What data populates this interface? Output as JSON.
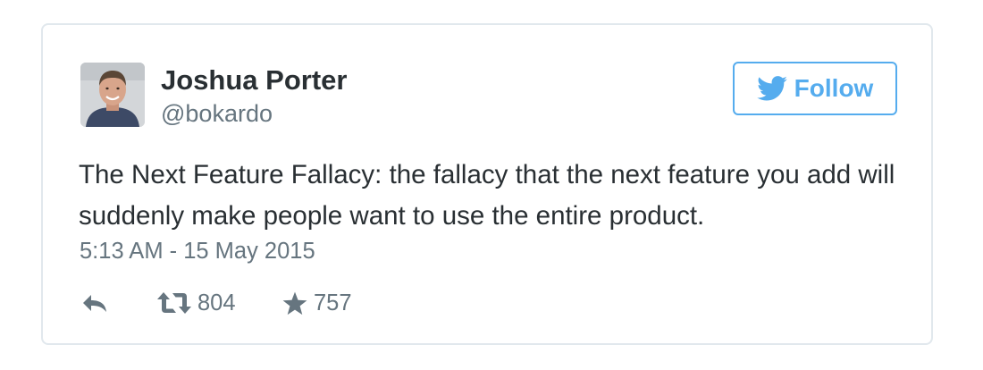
{
  "author": {
    "display_name": "Joshua Porter",
    "screen_name": "@bokardo",
    "avatar_icon": "profile-photo"
  },
  "follow_button": {
    "label": "Follow",
    "icon": "twitter-bird-icon",
    "color": "#55acee"
  },
  "tweet": {
    "text": "The Next Feature Fallacy: the fallacy that the next feature you add will suddenly make people want to use the entire product.",
    "timestamp": "5:13 AM - 15 May 2015"
  },
  "actions": {
    "reply_icon": "reply-icon",
    "retweet_icon": "retweet-icon",
    "retweet_count": "804",
    "favorite_icon": "star-icon",
    "favorite_count": "757"
  },
  "colors": {
    "text": "#292f33",
    "muted": "#66757f",
    "border": "#e1e8ed",
    "accent": "#55acee"
  }
}
